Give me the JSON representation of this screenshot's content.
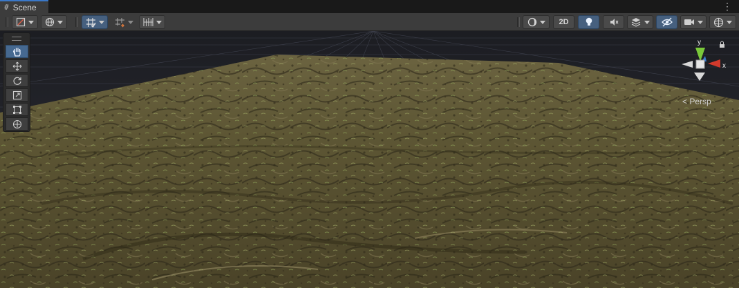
{
  "window": {
    "tab_label": "Scene",
    "tab_icon": "hash-icon",
    "tab_menu_icon": "more-vertical-icon"
  },
  "toolbar": {
    "left_buttons": [
      {
        "name": "draw-mode-button",
        "icon": "draw-mode-icon",
        "dropdown": true
      },
      {
        "name": "global-local-button",
        "icon": "globe-icon",
        "dropdown": true
      },
      {
        "name": "grid-snapping-button",
        "icon": "grid-snap-icon",
        "dropdown": true,
        "active": true
      },
      {
        "name": "increment-snap-button",
        "icon": "increment-snap-icon",
        "dropdown": true
      },
      {
        "name": "grid-visibility-button",
        "icon": "grid-icon",
        "dropdown": true
      }
    ],
    "right_buttons": [
      {
        "name": "shading-mode-button",
        "icon": "shading-sphere-icon",
        "dropdown": true
      },
      {
        "name": "2d-toggle-button",
        "text": "2D"
      },
      {
        "name": "lighting-toggle-button",
        "icon": "light-bulb-icon",
        "active": true
      },
      {
        "name": "audio-toggle-button",
        "icon": "audio-mute-icon"
      },
      {
        "name": "effects-button",
        "icon": "layers-icon",
        "dropdown": true
      },
      {
        "name": "visibility-toggle-button",
        "icon": "eye-slash-icon",
        "active": true
      },
      {
        "name": "camera-button",
        "icon": "camera-icon",
        "dropdown": true
      },
      {
        "name": "gizmos-button",
        "icon": "gizmo-sphere-icon",
        "dropdown": true
      }
    ],
    "label_2d": "2D"
  },
  "tools": [
    {
      "name": "hand-tool",
      "icon": "hand-icon",
      "active": true
    },
    {
      "name": "move-tool",
      "icon": "move-icon",
      "active": false
    },
    {
      "name": "rotate-tool",
      "icon": "rotate-icon",
      "active": false
    },
    {
      "name": "scale-tool",
      "icon": "scale-icon",
      "active": false
    },
    {
      "name": "rect-tool",
      "icon": "rect-icon",
      "active": false
    },
    {
      "name": "transform-tool",
      "icon": "transform-icon",
      "active": false
    }
  ],
  "gizmo": {
    "y_label": "y",
    "x_label": "x",
    "projection_label": "< Persp",
    "lock_icon": "lock-icon"
  },
  "colors": {
    "accent": "#46607f",
    "tab_accent": "#3a78c9",
    "axis_x": "#d23a2c",
    "axis_y": "#7ac83a",
    "axis_z": "#3a7bd2",
    "terrain": "#5b5530"
  }
}
